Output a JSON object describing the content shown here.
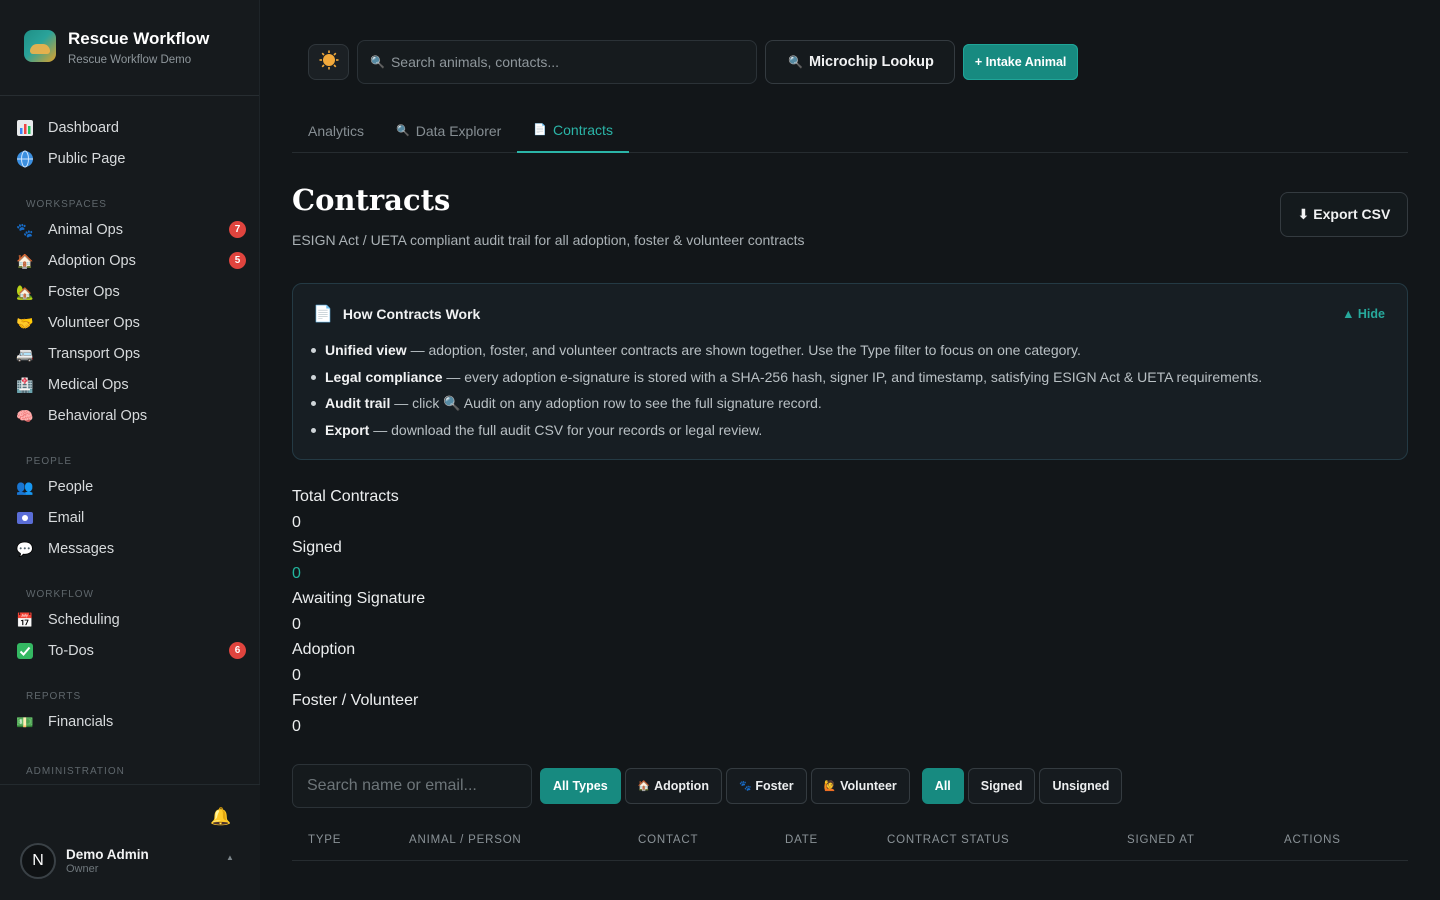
{
  "brand": {
    "title": "Rescue Workflow",
    "subtitle": "Rescue Workflow Demo"
  },
  "sidebar": {
    "top_items": [
      {
        "label": "Dashboard",
        "icon": "bar-chart-icon"
      },
      {
        "label": "Public Page",
        "icon": "globe-icon"
      }
    ],
    "sections": [
      {
        "title": "WORKSPACES",
        "items": [
          {
            "label": "Animal Ops",
            "icon": "paw-icon",
            "badge": "7"
          },
          {
            "label": "Adoption Ops",
            "icon": "house-icon",
            "badge": "5"
          },
          {
            "label": "Foster Ops",
            "icon": "house-icon"
          },
          {
            "label": "Volunteer Ops",
            "icon": "handshake-icon"
          },
          {
            "label": "Transport Ops",
            "icon": "truck-icon"
          },
          {
            "label": "Medical Ops",
            "icon": "medical-icon"
          },
          {
            "label": "Behavioral Ops",
            "icon": "brain-icon"
          }
        ]
      },
      {
        "title": "PEOPLE",
        "items": [
          {
            "label": "People",
            "icon": "people-icon"
          },
          {
            "label": "Email",
            "icon": "email-icon"
          },
          {
            "label": "Messages",
            "icon": "chat-icon"
          }
        ]
      },
      {
        "title": "WORKFLOW",
        "items": [
          {
            "label": "Scheduling",
            "icon": "calendar-icon"
          },
          {
            "label": "To-Dos",
            "icon": "checkbox-icon",
            "badge": "6"
          }
        ]
      },
      {
        "title": "REPORTS",
        "items": [
          {
            "label": "Financials",
            "icon": "money-icon"
          }
        ]
      },
      {
        "title": "ADMINISTRATION",
        "items": []
      }
    ],
    "user": {
      "initial": "N",
      "name": "Demo Admin",
      "role": "Owner"
    }
  },
  "topbar": {
    "search_placeholder": "Search animals, contacts...",
    "microchip_label": "Microchip Lookup",
    "intake_label": "+ Intake Animal"
  },
  "tabs": [
    {
      "label": "Analytics",
      "active": false
    },
    {
      "label": "Data Explorer",
      "active": false
    },
    {
      "label": "Contracts",
      "active": true
    }
  ],
  "page": {
    "title": "Contracts",
    "subtitle": "ESIGN Act / UETA compliant audit trail for all adoption, foster & volunteer contracts",
    "export_label": "⬇ Export CSV"
  },
  "info": {
    "title": "How Contracts Work",
    "hide_label": "▲ Hide",
    "items": [
      {
        "bold": "Unified view",
        "text": " — adoption, foster, and volunteer contracts are shown together. Use the Type filter to focus on one category."
      },
      {
        "bold": "Legal compliance",
        "text": " — every adoption e-signature is stored with a SHA-256 hash, signer IP, and timestamp, satisfying ESIGN Act & UETA requirements."
      },
      {
        "bold": "Audit trail",
        "text": " — click 🔍 Audit on any adoption row to see the full signature record."
      },
      {
        "bold": "Export",
        "text": " — download the full audit CSV for your records or legal review."
      }
    ]
  },
  "stats": [
    {
      "label": "Total Contracts",
      "value": "0"
    },
    {
      "label": "Signed",
      "value": "0"
    },
    {
      "label": "Awaiting Signature",
      "value": "0"
    },
    {
      "label": "Adoption",
      "value": "0"
    },
    {
      "label": "Foster / Volunteer",
      "value": "0"
    }
  ],
  "filters": {
    "search_placeholder": "Search name or email...",
    "types": [
      "All Types",
      "Adoption",
      "Foster",
      "Volunteer"
    ],
    "statuses": [
      "All",
      "Signed",
      "Unsigned"
    ]
  },
  "table": {
    "columns": [
      "TYPE",
      "ANIMAL / PERSON",
      "CONTACT",
      "DATE",
      "CONTRACT STATUS",
      "SIGNED AT",
      "ACTIONS"
    ]
  },
  "colors": {
    "accent": "#178a80",
    "badge": "#e0443e",
    "signed_value": "#22b59d"
  }
}
